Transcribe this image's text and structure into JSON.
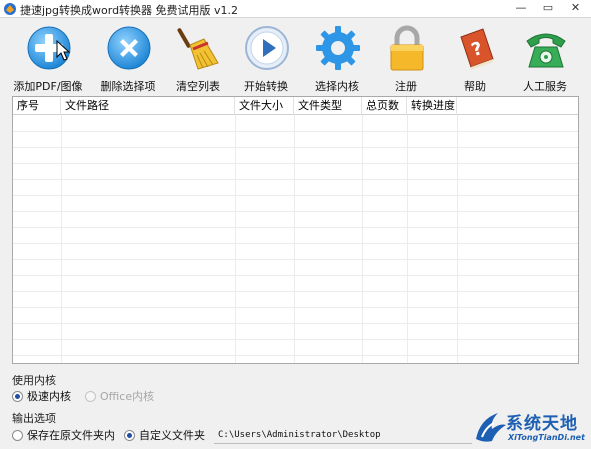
{
  "window": {
    "title": "捷速jpg转换成word转换器 免费试用版 v1.2",
    "minimize_glyph": "—",
    "maximize_glyph": "▭",
    "close_glyph": "✕"
  },
  "toolbar": {
    "items": [
      {
        "label": "添加PDF/图像",
        "icon": "add-plus-icon"
      },
      {
        "label": "删除选择项",
        "icon": "delete-x-icon"
      },
      {
        "label": "清空列表",
        "icon": "broom-icon"
      },
      {
        "label": "开始转换",
        "icon": "play-icon"
      },
      {
        "label": "选择内核",
        "icon": "gear-icon"
      },
      {
        "label": "注册",
        "icon": "lock-icon"
      },
      {
        "label": "帮助",
        "icon": "help-book-icon"
      },
      {
        "label": "人工服务",
        "icon": "phone-icon"
      }
    ]
  },
  "table": {
    "columns": [
      "序号",
      "文件路径",
      "文件大小",
      "文件类型",
      "总页数",
      "转换进度"
    ],
    "rows": []
  },
  "engine": {
    "title": "使用内核",
    "options": [
      {
        "label": "极速内核",
        "checked": true,
        "disabled": false
      },
      {
        "label": "Office内核",
        "checked": false,
        "disabled": true
      }
    ]
  },
  "output": {
    "title": "输出选项",
    "options": [
      {
        "label": "保存在原文件夹内",
        "checked": false
      },
      {
        "label": "自定义文件夹",
        "checked": true
      }
    ],
    "path": "C:\\Users\\Administrator\\Desktop"
  },
  "watermark": {
    "title": "系统天地",
    "subtitle": "XiTongTianDi.net"
  },
  "colors": {
    "accent": "#1d5fb3",
    "window_bg": "#f0f0f0",
    "table_border": "#a9a9a9"
  }
}
